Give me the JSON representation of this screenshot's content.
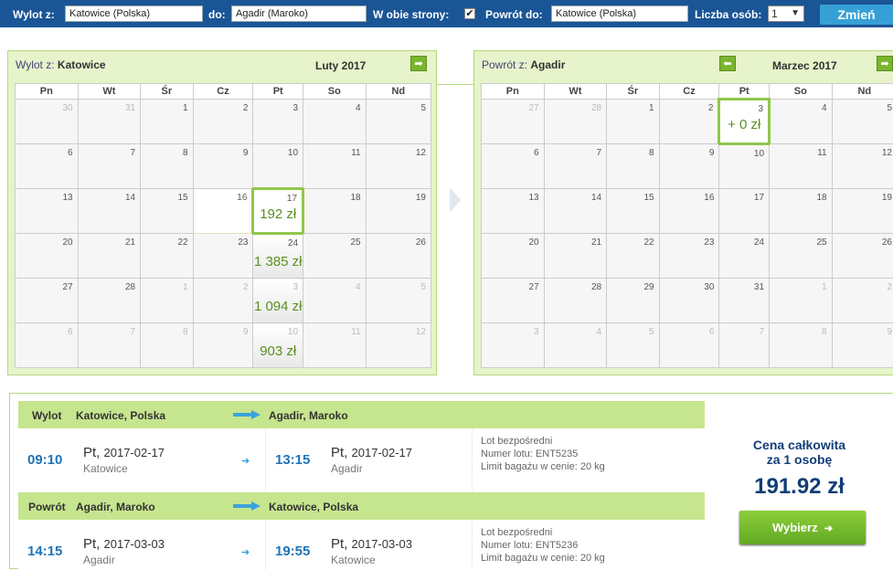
{
  "search": {
    "from_label": "Wylot z:",
    "from_value": "Katowice (Polska)",
    "to_label": "do:",
    "to_value": "Agadir (Maroko)",
    "roundtrip_label": "W obie strony:",
    "roundtrip_checked": "✔",
    "return_label": "Powrót do:",
    "return_value": "Katowice (Polska)",
    "persons_label": "Liczba osób:",
    "persons_value": "1",
    "dropdown_arrow": "▼",
    "submit_label": "Zmień"
  },
  "weekdays": [
    "Pn",
    "Wt",
    "Śr",
    "Cz",
    "Pt",
    "So",
    "Nd"
  ],
  "outbound_calendar": {
    "from_prefix": "Wylot z:",
    "from_city": "Katowice",
    "month": "Luty 2017",
    "next_icon": "➡",
    "weeks": [
      [
        {
          "d": "30",
          "o": true
        },
        {
          "d": "31",
          "o": true
        },
        {
          "d": "1"
        },
        {
          "d": "2"
        },
        {
          "d": "3"
        },
        {
          "d": "4"
        },
        {
          "d": "5"
        }
      ],
      [
        {
          "d": "6"
        },
        {
          "d": "7"
        },
        {
          "d": "8"
        },
        {
          "d": "9"
        },
        {
          "d": "10"
        },
        {
          "d": "11"
        },
        {
          "d": "12"
        }
      ],
      [
        {
          "d": "13"
        },
        {
          "d": "14"
        },
        {
          "d": "15"
        },
        {
          "d": "16",
          "hl": true
        },
        {
          "d": "17",
          "p": "192 zł",
          "sel": true
        },
        {
          "d": "18"
        },
        {
          "d": "19"
        }
      ],
      [
        {
          "d": "20"
        },
        {
          "d": "21"
        },
        {
          "d": "22"
        },
        {
          "d": "23"
        },
        {
          "d": "24",
          "p": "1 385 zł"
        },
        {
          "d": "25"
        },
        {
          "d": "26"
        }
      ],
      [
        {
          "d": "27"
        },
        {
          "d": "28"
        },
        {
          "d": "1",
          "o": true
        },
        {
          "d": "2",
          "o": true
        },
        {
          "d": "3",
          "o": true,
          "p": "1 094 zł"
        },
        {
          "d": "4",
          "o": true
        },
        {
          "d": "5",
          "o": true
        }
      ],
      [
        {
          "d": "6",
          "o": true
        },
        {
          "d": "7",
          "o": true
        },
        {
          "d": "8",
          "o": true
        },
        {
          "d": "9",
          "o": true
        },
        {
          "d": "10",
          "o": true,
          "p": "903 zł"
        },
        {
          "d": "11",
          "o": true
        },
        {
          "d": "12",
          "o": true
        }
      ]
    ]
  },
  "return_calendar": {
    "from_prefix": "Powrót z:",
    "from_city": "Agadir",
    "month": "Marzec 2017",
    "prev_icon": "⬅",
    "next_icon": "➡",
    "weeks": [
      [
        {
          "d": "27",
          "o": true
        },
        {
          "d": "28",
          "o": true
        },
        {
          "d": "1"
        },
        {
          "d": "2"
        },
        {
          "d": "3",
          "p": "+ 0 zł",
          "sel": true
        },
        {
          "d": "4"
        },
        {
          "d": "5"
        }
      ],
      [
        {
          "d": "6"
        },
        {
          "d": "7"
        },
        {
          "d": "8"
        },
        {
          "d": "9"
        },
        {
          "d": "10"
        },
        {
          "d": "11"
        },
        {
          "d": "12"
        }
      ],
      [
        {
          "d": "13"
        },
        {
          "d": "14"
        },
        {
          "d": "15"
        },
        {
          "d": "16"
        },
        {
          "d": "17"
        },
        {
          "d": "18"
        },
        {
          "d": "19"
        }
      ],
      [
        {
          "d": "20"
        },
        {
          "d": "21"
        },
        {
          "d": "22"
        },
        {
          "d": "23"
        },
        {
          "d": "24"
        },
        {
          "d": "25"
        },
        {
          "d": "26"
        }
      ],
      [
        {
          "d": "27"
        },
        {
          "d": "28"
        },
        {
          "d": "29"
        },
        {
          "d": "30"
        },
        {
          "d": "31"
        },
        {
          "d": "1",
          "o": true
        },
        {
          "d": "2",
          "o": true
        }
      ],
      [
        {
          "d": "3",
          "o": true
        },
        {
          "d": "4",
          "o": true
        },
        {
          "d": "5",
          "o": true
        },
        {
          "d": "6",
          "o": true
        },
        {
          "d": "7",
          "o": true
        },
        {
          "d": "8",
          "o": true
        },
        {
          "d": "9",
          "o": true
        }
      ]
    ]
  },
  "outbound": {
    "label": "Wylot",
    "from": "Katowice, Polska",
    "to": "Agadir, Maroko",
    "dep_time": "09:10",
    "dep_day": "Pt,",
    "dep_date": "2017-02-17",
    "dep_city": "Katowice",
    "arr_time": "13:15",
    "arr_day": "Pt,",
    "arr_date": "2017-02-17",
    "arr_city": "Agadir",
    "small_arrow": "➔",
    "direct": "Lot bezpośredni",
    "flight_no": "Numer lotu: ENT5235",
    "baggage": "Limit bagażu w cenie: 20 kg"
  },
  "return": {
    "label": "Powrót",
    "from": "Agadir, Maroko",
    "to": "Katowice, Polska",
    "dep_time": "14:15",
    "dep_day": "Pt,",
    "dep_date": "2017-03-03",
    "dep_city": "Agadir",
    "arr_time": "19:55",
    "arr_day": "Pt,",
    "arr_date": "2017-03-03",
    "arr_city": "Katowice",
    "small_arrow": "➔",
    "direct": "Lot bezpośredni",
    "flight_no": "Numer lotu: ENT5236",
    "baggage": "Limit bagażu w cenie: 20 kg"
  },
  "price": {
    "title_line1": "Cena całkowita",
    "title_line2": "za 1 osobę",
    "amount": "191.92 zł",
    "button_label": "Wybierz",
    "button_arrow": "➔"
  },
  "colors": {
    "topbar": "#1a5596",
    "accent_green": "#79b52e",
    "price_blue": "#123e77",
    "time_blue": "#1f73b7"
  }
}
